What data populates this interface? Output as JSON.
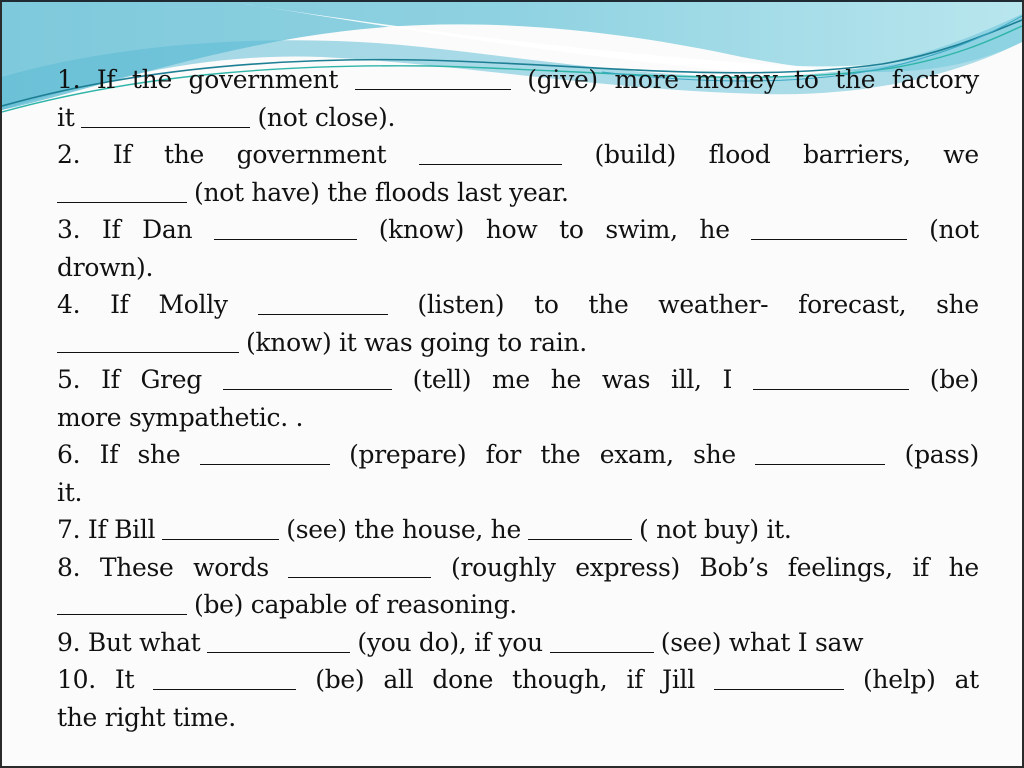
{
  "slide": {
    "border_color": "#2b2b2b",
    "wave_colors": {
      "light": "#a8dfe8",
      "mid": "#7cc8dc",
      "dark": "#4fb3cf",
      "accent_line": "#1d7f94",
      "teal_line": "#2fb5a8"
    }
  },
  "exercise": {
    "lines": [
      {
        "item": "1",
        "segments": [
          "1.",
          "If",
          "the",
          "government",
          "__blank__",
          "(give)",
          "more",
          "money",
          "to",
          "the",
          "factory"
        ],
        "justify": true
      },
      {
        "item": "1",
        "segments": [
          "it",
          "__blank__",
          "(not close)."
        ],
        "justify": false
      },
      {
        "item": "2",
        "segments": [
          "2.",
          "If",
          "the",
          "government",
          "__blank__",
          "(build)",
          "flood",
          "barriers,",
          "we"
        ],
        "justify": true
      },
      {
        "item": "2",
        "segments": [
          "__blank__",
          "(not have) the floods last year."
        ],
        "justify": false
      },
      {
        "item": "3",
        "segments": [
          "3.",
          "If",
          "Dan",
          "__blank__",
          "(know)",
          "how",
          "to",
          "swim,",
          "he",
          "__blank__",
          "(not"
        ],
        "justify": true
      },
      {
        "item": "3",
        "segments": [
          "drown)."
        ],
        "justify": false
      },
      {
        "item": "4",
        "segments": [
          "4.",
          "If",
          "Molly",
          "__blank__",
          "(listen)",
          "to",
          "the",
          "weather-",
          "forecast,",
          "she"
        ],
        "justify": true
      },
      {
        "item": "4",
        "segments": [
          "__blank__",
          "(know) it was going to rain."
        ],
        "justify": false
      },
      {
        "item": "5",
        "segments": [
          "5.",
          "If",
          "Greg",
          "__blank__",
          "(tell)",
          "me",
          "he",
          "was",
          "ill,",
          "I",
          "__blank__",
          "(be)"
        ],
        "justify": true
      },
      {
        "item": "5",
        "segments": [
          "more sympathetic. ."
        ],
        "justify": false
      },
      {
        "item": "6",
        "segments": [
          "6.",
          "If",
          "she",
          "__blank__",
          "(prepare)",
          "for",
          "the",
          "exam,",
          "she",
          "__blank__",
          "(pass)"
        ],
        "justify": true
      },
      {
        "item": "6",
        "segments": [
          "it."
        ],
        "justify": false
      },
      {
        "item": "7",
        "segments": [
          "7. If Bill",
          "__blank__",
          "(see) the house, he",
          "__blank__",
          "( not buy) it."
        ],
        "justify": false
      },
      {
        "item": "8",
        "segments": [
          "8.",
          "These",
          "words",
          "__blank__",
          "(roughly",
          "express)",
          "Bob’s",
          "feelings,",
          "if",
          "he"
        ],
        "justify": true
      },
      {
        "item": "8",
        "segments": [
          "__blank__",
          "(be) capable of reasoning."
        ],
        "justify": false
      },
      {
        "item": "9",
        "segments": [
          "9. But what",
          "__blank__",
          "(you do), if you",
          "__blank__",
          "(see) what I saw"
        ],
        "justify": false
      },
      {
        "item": "10",
        "segments": [
          "10.",
          "It",
          "__blank__",
          "(be)",
          "all",
          "done",
          "though,",
          "if",
          "Jill",
          "__blank__",
          "(help)",
          "at"
        ],
        "justify": true
      },
      {
        "item": "10",
        "segments": [
          "the right time."
        ],
        "justify": false
      }
    ],
    "blank_widths_chars": [
      [
        12
      ],
      [
        13
      ],
      [
        11
      ],
      [
        10
      ],
      [
        11,
        12
      ],
      [],
      [
        10
      ],
      [
        14
      ],
      [
        13,
        12
      ],
      [],
      [
        10,
        10
      ],
      [],
      [
        9,
        8
      ],
      [
        11
      ],
      [
        10
      ],
      [
        11,
        8
      ],
      [
        11,
        10
      ],
      []
    ]
  }
}
